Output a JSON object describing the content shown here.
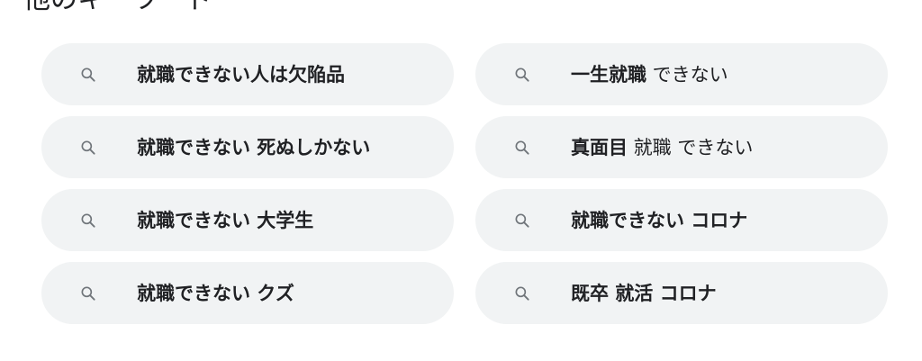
{
  "section": {
    "title": "他のキーワード"
  },
  "icons": {
    "search": "search-icon",
    "color": "#70757a"
  },
  "colors": {
    "chip_bg": "#f1f3f4",
    "text": "#202124"
  },
  "suggestions": [
    {
      "bold": "就職できない人は欠陥品",
      "normal": ""
    },
    {
      "bold": "一生就職",
      "normal": " できない"
    },
    {
      "bold": "就職できない 死ぬしかない",
      "normal": ""
    },
    {
      "bold": "真面目",
      "normal": " 就職 できない"
    },
    {
      "bold": "就職できない 大学生",
      "normal": ""
    },
    {
      "bold": "就職できない コロナ",
      "normal": ""
    },
    {
      "bold": "就職できない クズ",
      "normal": ""
    },
    {
      "bold": "既卒 就活 コロナ",
      "normal": ""
    }
  ]
}
